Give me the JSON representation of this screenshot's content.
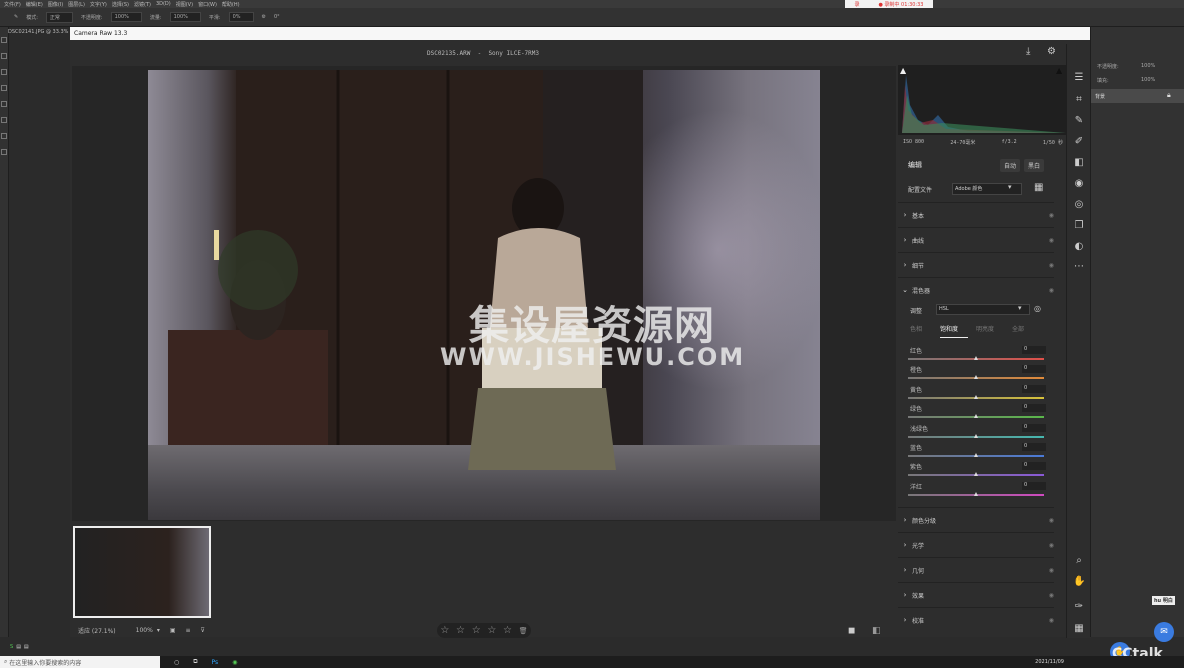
{
  "ps_menu": [
    "文件(F)",
    "编辑(E)",
    "图像(I)",
    "图层(L)",
    "文字(Y)",
    "选择(S)",
    "滤镜(T)",
    "3D(D)",
    "视图(V)",
    "窗口(W)",
    "帮助(H)"
  ],
  "ps_options": {
    "mode_label": "模式:",
    "mode_value": "正常",
    "opacity_label": "不透明度:",
    "opacity_value": "100%",
    "flow_label": "流量:",
    "flow_value": "100%",
    "smooth_label": "平滑:",
    "smooth_value": "0%",
    "angle_value": "0°"
  },
  "recording": {
    "indicator": "录",
    "timer": "● 录制中 01:30:33"
  },
  "doc_tab": "DSC02141.JPG @ 33.3%",
  "cr_title": "Camera Raw 13.3",
  "header": {
    "filename": "DSC02135.ARW",
    "separator": "-",
    "camera": "Sony ILCE-7RM3"
  },
  "watermark": {
    "cn": "集设屋资源网",
    "en": "WWW.JISHEWU.COM"
  },
  "bottom": {
    "zoom_fit": "适应 (27.1%)",
    "zoom_pct": "100%",
    "stars": [
      "☆",
      "☆",
      "☆",
      "☆",
      "☆"
    ],
    "trash": "🗑"
  },
  "caminfo": {
    "iso": "ISO 800",
    "lens": "24-70毫米",
    "aperture": "f/3.2",
    "shutter": "1/50 秒"
  },
  "panel": {
    "edit_title": "编辑",
    "auto": "自动",
    "bw": "黑白",
    "profile_label": "配置文件",
    "profile_value": "Adobe 颜色",
    "sections_top": [
      "基本",
      "曲线",
      "细节"
    ],
    "color_mixer": "混色器",
    "adjust_label": "调整",
    "adjust_value": "HSL",
    "tabs": [
      "色相",
      "饱和度",
      "明亮度",
      "全部"
    ],
    "sliders": [
      {
        "label": "红色",
        "value": "0",
        "color": "#e0504a"
      },
      {
        "label": "橙色",
        "value": "0",
        "color": "#e08a3a"
      },
      {
        "label": "黄色",
        "value": "0",
        "color": "#d8c23a"
      },
      {
        "label": "绿色",
        "value": "0",
        "color": "#5ab84a"
      },
      {
        "label": "浅绿色",
        "value": "0",
        "color": "#45b8b0"
      },
      {
        "label": "蓝色",
        "value": "0",
        "color": "#4a7ad8"
      },
      {
        "label": "紫色",
        "value": "0",
        "color": "#8a5ad8"
      },
      {
        "label": "洋红",
        "value": "0",
        "color": "#d04ac0"
      }
    ],
    "sections_bottom": [
      "颜色分级",
      "光学",
      "几何",
      "效果",
      "校准"
    ]
  },
  "psright": {
    "layer_name": "背景",
    "opacity_label": "不透明度:",
    "opacity_value": "100%",
    "fill_label": "填充:",
    "fill_value": "100%"
  },
  "taskbar": {
    "search_placeholder": "在这里输入你要搜索的内容",
    "clock": "2021/11/09"
  },
  "cctalk": {
    "logo": "CCtalk",
    "hint": "hu 明白"
  }
}
